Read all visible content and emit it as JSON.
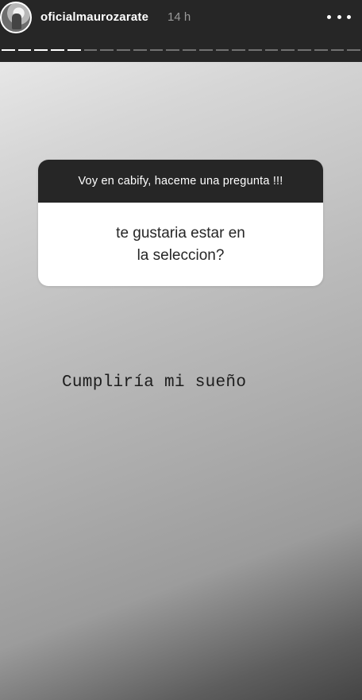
{
  "header": {
    "username": "oficialmaurozarate",
    "time_ago": "14 h",
    "more_icon": "more-horizontal-icon",
    "progress": {
      "total_segments": 22,
      "completed_segments": 5
    }
  },
  "question_sticker": {
    "prompt": "Voy en cabify, haceme una pregunta !!!",
    "question_line1": "te gustaria estar en",
    "question_line2": "la seleccion?"
  },
  "answer_text": "Cumpliría mi sueño"
}
